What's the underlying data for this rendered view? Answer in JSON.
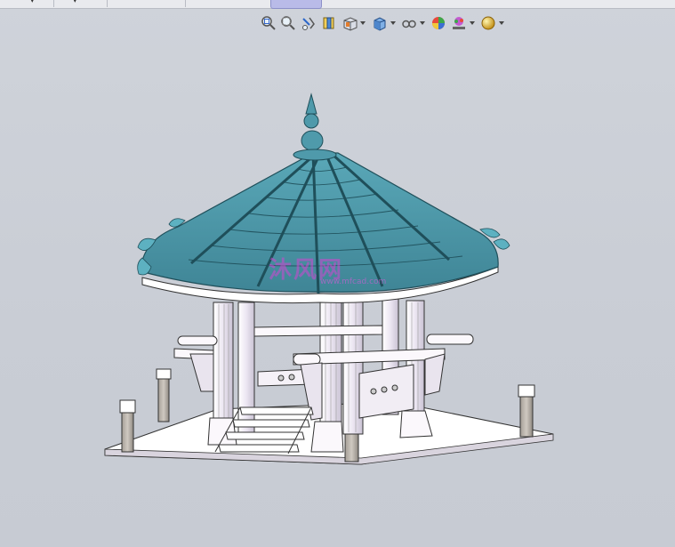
{
  "toolbar": {
    "icons": [
      "zoom-to-fit-icon",
      "zoom-to-area-icon",
      "previous-view-icon",
      "section-view-icon",
      "view-orientation-icon",
      "display-style-icon",
      "hide-show-items-icon",
      "edit-appearance-icon",
      "apply-scene-icon",
      "view-settings-icon"
    ]
  },
  "model": {
    "name": "hexagonal-pavilion",
    "roof_color": "#4f9aab",
    "body_color": "#f4f0f6"
  },
  "watermark": {
    "text": "沐风网",
    "sub": "www.mfcad.com"
  }
}
